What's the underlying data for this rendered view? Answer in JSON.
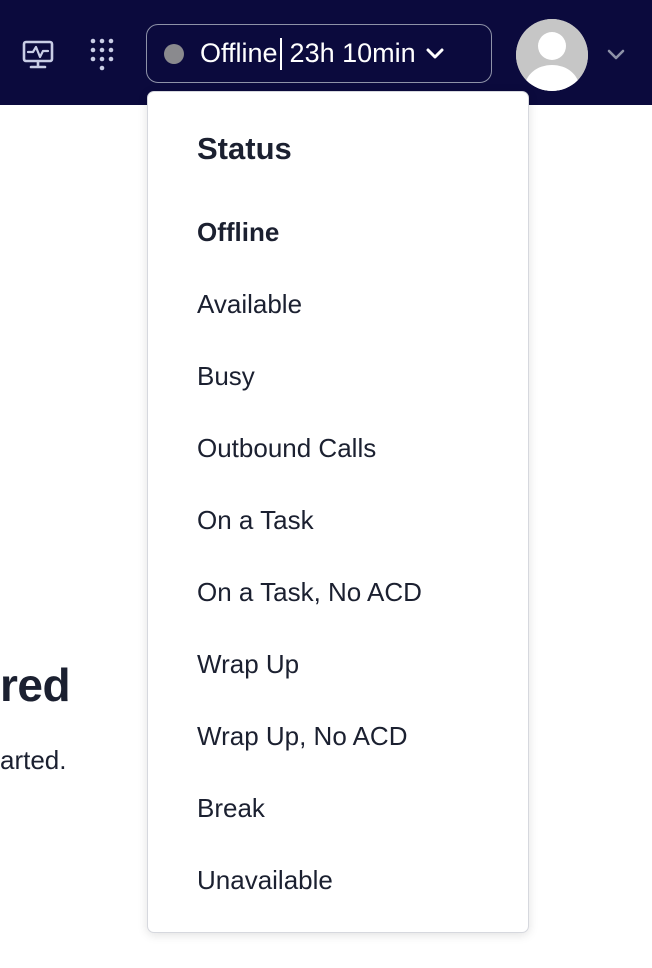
{
  "topbar": {
    "background": "#0b0a3d",
    "icons": {
      "monitor": "monitor-icon",
      "grid": "dialpad-grid-icon",
      "chevron": "chevron-down-icon",
      "avatar": "user-avatar-icon"
    },
    "status_button": {
      "state": "Offline",
      "duration": "23h 10min",
      "dot_color": "#8a8a8e"
    }
  },
  "background_page": {
    "heading_fragment": "red",
    "text_fragment": "arted."
  },
  "status_menu": {
    "title": "Status",
    "selected": "Offline",
    "items": [
      {
        "label": "Offline",
        "selected": true
      },
      {
        "label": "Available",
        "selected": false
      },
      {
        "label": "Busy",
        "selected": false
      },
      {
        "label": "Outbound Calls",
        "selected": false
      },
      {
        "label": "On a Task",
        "selected": false
      },
      {
        "label": "On a Task, No ACD",
        "selected": false
      },
      {
        "label": "Wrap Up",
        "selected": false
      },
      {
        "label": "Wrap Up, No ACD",
        "selected": false
      },
      {
        "label": "Break",
        "selected": false
      },
      {
        "label": "Unavailable",
        "selected": false
      }
    ]
  }
}
